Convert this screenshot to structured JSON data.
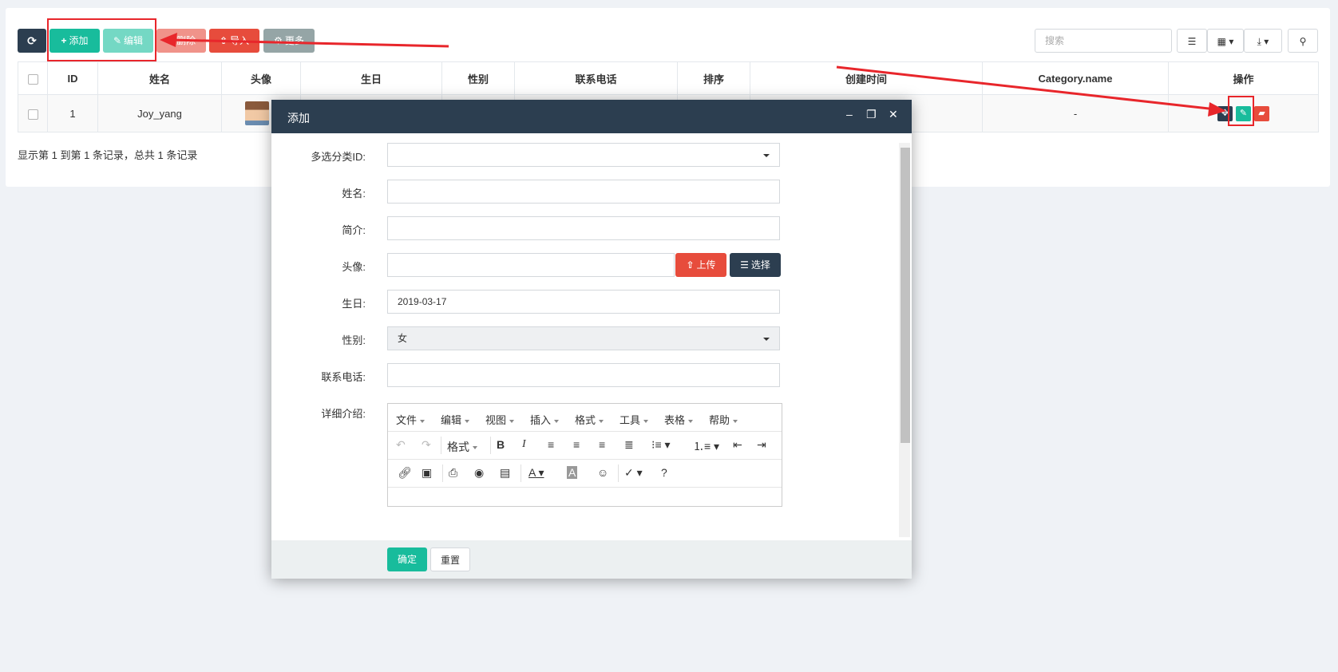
{
  "toolbar": {
    "refresh_label": "",
    "add_label": "添加",
    "edit_label": "编辑",
    "delete_label": "删除",
    "import_label": "导入",
    "more_label": "更多",
    "search_placeholder": "搜索"
  },
  "table": {
    "headers": [
      "ID",
      "姓名",
      "头像",
      "生日",
      "性别",
      "联系电话",
      "排序",
      "创建时间",
      "Category.name",
      "操作"
    ],
    "rows": [
      {
        "id": "1",
        "name": "Joy_yang",
        "category_name": "-"
      }
    ]
  },
  "pager": {
    "summary": "显示第 1 到第 1 条记录，总共 1 条记录"
  },
  "modal": {
    "title": "添加",
    "fields": {
      "category_label": "多选分类ID:",
      "name_label": "姓名:",
      "intro_label": "简介:",
      "avatar_label": "头像:",
      "upload_label": "上传",
      "choose_label": "选择",
      "birthday_label": "生日:",
      "birthday_value": "2019-03-17",
      "gender_label": "性别:",
      "gender_value": "女",
      "phone_label": "联系电话:",
      "detail_label": "详细介绍:"
    },
    "editor": {
      "menus": [
        "文件",
        "编辑",
        "视图",
        "插入",
        "格式",
        "工具",
        "表格",
        "帮助"
      ],
      "format_label": "格式"
    },
    "confirm_label": "确定",
    "reset_label": "重置"
  },
  "colors": {
    "dark": "#2c3e50",
    "green": "#18bc9c",
    "red": "#e74c3c",
    "gray": "#95a5a6",
    "annotation": "#e8262b"
  }
}
